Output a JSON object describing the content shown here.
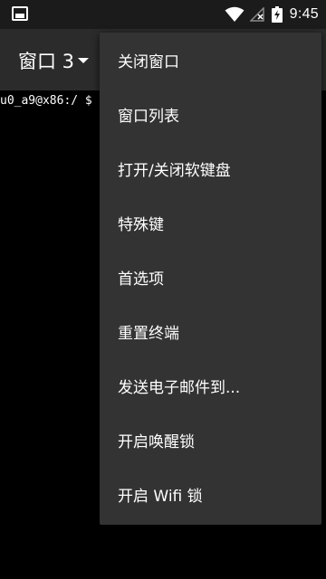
{
  "status_bar": {
    "time": "9:45",
    "icons": [
      "terminal-notification-icon",
      "wifi-icon",
      "signal-icon",
      "battery-charging-icon"
    ]
  },
  "action_bar": {
    "window_title": "窗口 3"
  },
  "terminal": {
    "prompt": "u0_a9@x86:/ $"
  },
  "menu": {
    "items": [
      {
        "label": "关闭窗口"
      },
      {
        "label": "窗口列表"
      },
      {
        "label": "打开/关闭软键盘"
      },
      {
        "label": "特殊键"
      },
      {
        "label": "首选项"
      },
      {
        "label": "重置终端"
      },
      {
        "label": "发送电子邮件到..."
      },
      {
        "label": "开启唤醒锁"
      },
      {
        "label": "开启 Wifi 锁"
      }
    ]
  },
  "colors": {
    "status_bar_bg": "#1b1b1b",
    "action_bar_bg": "#2b2b2b",
    "menu_bg": "#333333",
    "terminal_bg": "#000000",
    "text": "#ffffff"
  }
}
